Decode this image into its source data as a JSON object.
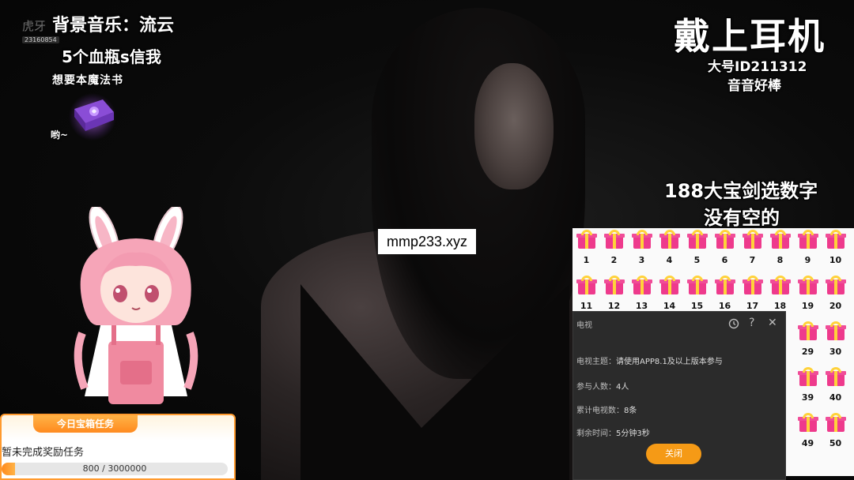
{
  "overlay_left": {
    "logo": "虎牙",
    "logo_id": "23160854",
    "bgm": "背景音乐：流云",
    "bottles": "5个血瓶s信我",
    "book_caption": "想要本魔法书",
    "book_sound": "哟~"
  },
  "overlay_right": {
    "headphones": "戴上耳机",
    "big_id": "大号ID211312",
    "yinyin": "音音好棒",
    "sword": "188大宝剑选数字",
    "no_empty": "没有空的"
  },
  "watermark": "mmp233.xyz",
  "gift_grid": {
    "numbers": [
      "1",
      "2",
      "3",
      "4",
      "5",
      "6",
      "7",
      "8",
      "9",
      "10",
      "11",
      "12",
      "13",
      "14",
      "15",
      "16",
      "17",
      "18",
      "19",
      "20",
      "29",
      "30",
      "39",
      "40",
      "49",
      "50"
    ],
    "gift_color": "#ee3a8c",
    "ribbon_color": "#ffd23a"
  },
  "dialog": {
    "title": "电视",
    "history_icon": "history-icon",
    "help_icon": "?",
    "close_icon": "✕",
    "rows": [
      {
        "label": "电视主题：",
        "value": "请使用APP8.1及以上版本参与"
      },
      {
        "label": "参与人数：",
        "value": "4人"
      },
      {
        "label": "累计电视数：",
        "value": "8条"
      },
      {
        "label": "剩余时间：",
        "value": "5分钟3秒"
      }
    ],
    "close_label": "关闭",
    "accent": "#f59a16"
  },
  "task_panel": {
    "title": "今日宝箱任务",
    "text": "暂未完成奖励任务",
    "progress_current": 800,
    "progress_total": 3000000,
    "progress_label": "800 / 3000000"
  }
}
